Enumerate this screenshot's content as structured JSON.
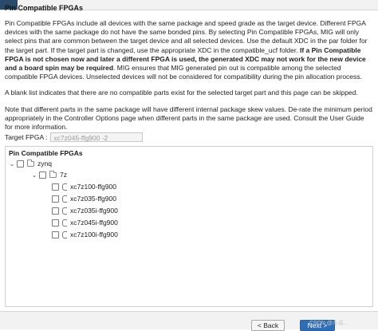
{
  "header": {
    "title": "Pin Compatible FPGAs"
  },
  "paragraphs": {
    "p1_part1": "Pin Compatible FPGAs include all devices with the same package and speed grade as the target device. Different FPGA devices with the same package do not have the same bonded pins. By selecting Pin Compatible FPGAs, MIG will only select pins that are common between the target device and all selected devices. Use the default XDC in the par folder for the target part. If the target part is changed, use the appropriate XDC in the compatible_ucf folder. ",
    "p1_bold": "If a Pin Compatible FPGA is not chosen now and later a different FPGA is used, the generated XDC may not work for the new device and a board spin may be required",
    "p1_part2": ". MIG ensures that MIG generated pin out is compatible among the selected compatible FPGA devices. Unselected devices will not be considered for compatibility during the pin allocation process.",
    "p2": "A blank list indicates that there are no compatible parts exist for the selected target part and this page can be skipped.",
    "p3": "Note that different parts in the same package will have different internal package skew values. De-rate the minimum period appropriately in the Controller Options page when different parts in the same package are used. Consult the User Guide for more information."
  },
  "target": {
    "label": "Target FPGA :",
    "value": "xc7z045-ffg900 -2"
  },
  "tree": {
    "title": "Pin Compatible FPGAs",
    "family": "zynq",
    "group": "7z",
    "parts": [
      "xc7z100-ffg900",
      "xc7z035-ffg900",
      "xc7z035i-ffg900",
      "xc7z045i-ffg900",
      "xc7z100i-ffg900"
    ]
  },
  "footer": {
    "back_label": "< Back",
    "next_label": "Next >",
    "watermark": "CSDN @木易..."
  },
  "colors": {
    "accent": "#2f6db5",
    "header_accent": "#2b4a6b"
  },
  "icons": [
    "chevron-down-icon",
    "checkbox-icon",
    "folder-icon",
    "chip-icon"
  ]
}
